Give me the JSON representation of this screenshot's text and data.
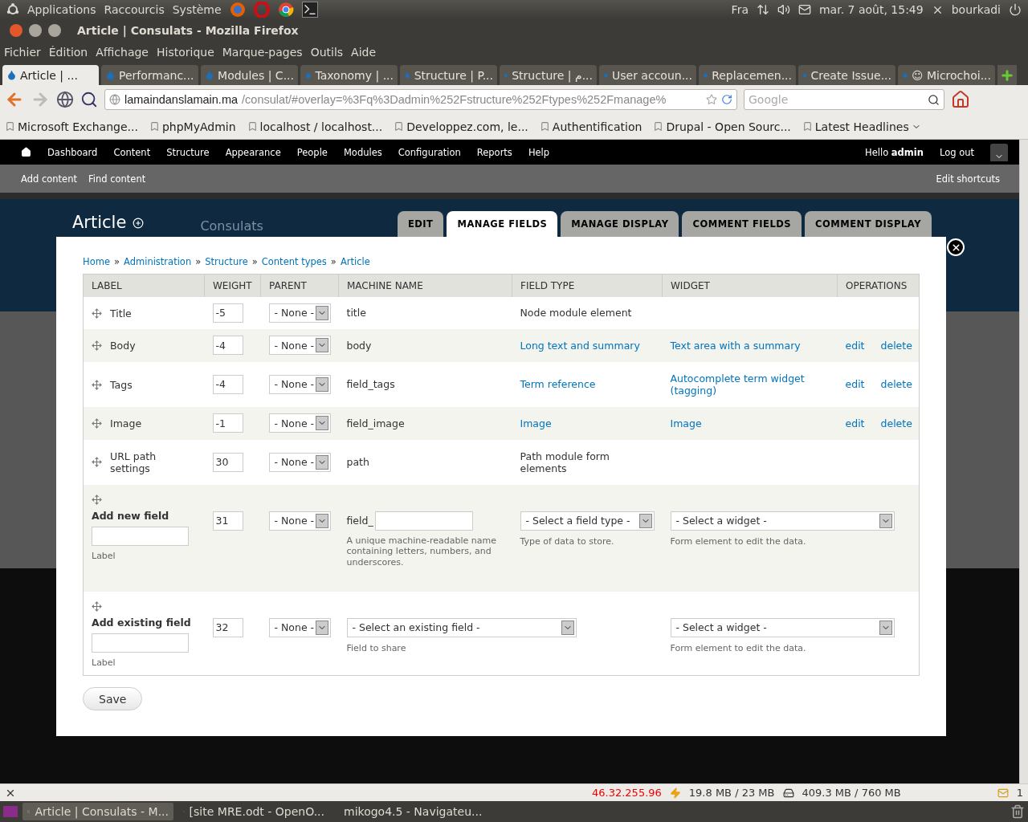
{
  "panel": {
    "menus": [
      "Applications",
      "Raccourcis",
      "Système"
    ],
    "keyboard": "Fra",
    "clock": "mar.  7 août, 15:49",
    "user": "bourkadi"
  },
  "window": {
    "title": "Article | Consulats - Mozilla Firefox"
  },
  "menubar": [
    "Fichier",
    "Édition",
    "Affichage",
    "Historique",
    "Marque-pages",
    "Outils",
    "Aide"
  ],
  "tabs": [
    {
      "label": "Article | ...",
      "selected": true
    },
    {
      "label": "Performanc...",
      "selected": false
    },
    {
      "label": "Modules | C...",
      "selected": false
    },
    {
      "label": "Taxonomy | ...",
      "selected": false
    },
    {
      "label": "Structure | P...",
      "selected": false
    },
    {
      "label": "Structure | م...",
      "selected": false
    },
    {
      "label": "User accoun...",
      "selected": false
    },
    {
      "label": "Replacemen...",
      "selected": false
    },
    {
      "label": "Create Issue...",
      "selected": false
    },
    {
      "label": "☺ Microchoi...",
      "selected": false
    }
  ],
  "address": {
    "host": "lamaindanslamain.ma",
    "path": "/consulat/#overlay=%3Fq%3Dadmin%252Fstructure%252Ftypes%252Fmanage%"
  },
  "search": {
    "placeholder": "Google"
  },
  "bookmarks": [
    "Microsoft Exchange...",
    "phpMyAdmin",
    "localhost / localhost...",
    "Developpez.com, le...",
    "Authentification",
    "Drupal - Open Sourc...",
    "Latest Headlines"
  ],
  "toolbar": {
    "items": [
      "Dashboard",
      "Content",
      "Structure",
      "Appearance",
      "People",
      "Modules",
      "Configuration",
      "Reports",
      "Help"
    ],
    "greeting": "Hello **admin**",
    "logout": "Log out",
    "shortcuts": [
      "Add content",
      "Find content"
    ],
    "edit_shortcuts": "Edit shortcuts"
  },
  "header": {
    "title": "Article",
    "site_name": "Consulats",
    "tabs": [
      {
        "label": "EDIT",
        "selected": false
      },
      {
        "label": "MANAGE FIELDS",
        "selected": true
      },
      {
        "label": "MANAGE DISPLAY",
        "selected": false
      },
      {
        "label": "COMMENT FIELDS",
        "selected": false
      },
      {
        "label": "COMMENT DISPLAY",
        "selected": false
      }
    ]
  },
  "breadcrumb": [
    {
      "label": "Home",
      "separator": "»"
    },
    {
      "label": "Administration",
      "separator": "»"
    },
    {
      "label": "Structure",
      "separator": "»"
    },
    {
      "label": "Content types",
      "separator": "»"
    },
    {
      "label": "Article"
    }
  ],
  "table": {
    "columns": [
      "LABEL",
      "WEIGHT",
      "PARENT",
      "MACHINE NAME",
      "FIELD TYPE",
      "WIDGET",
      "OPERATIONS"
    ],
    "rows": [
      {
        "kind": "field",
        "label": "Title",
        "weight": "-5",
        "parent": "- None -",
        "machine_name": "title",
        "field_type": "Node module element",
        "linked": false
      },
      {
        "kind": "field",
        "label": "Body",
        "weight": "-4",
        "parent": "- None -",
        "machine_name": "body",
        "field_type": "Long text and summary",
        "widget": "Text area with a summary",
        "operations": [
          "edit",
          "delete"
        ],
        "linked": true
      },
      {
        "kind": "field",
        "label": "Tags",
        "weight": "-4",
        "parent": "- None -",
        "machine_name": "field_tags",
        "field_type": "Term reference",
        "widget": "Autocomplete term widget (tagging)",
        "operations": [
          "edit",
          "delete"
        ],
        "linked": true
      },
      {
        "kind": "field",
        "label": "Image",
        "weight": "-1",
        "parent": "- None -",
        "machine_name": "field_image",
        "field_type": "Image",
        "widget": "Image",
        "operations": [
          "edit",
          "delete"
        ],
        "linked": true
      },
      {
        "kind": "field",
        "label": "URL path settings",
        "weight": "30",
        "parent": "- None -",
        "machine_name": "path",
        "field_type": "Path module form elements",
        "linked": false
      },
      {
        "kind": "new",
        "label": "Add new field",
        "label_hint": "Label",
        "weight": "31",
        "parent": "- None -",
        "machine_prefix": "field_",
        "machine_hint": "A unique machine-readable name containing letters, numbers, and underscores.",
        "type_select": "- Select a field type -",
        "type_hint": "Type of data to store.",
        "widget_select": "- Select a widget -",
        "widget_hint": "Form element to edit the data."
      },
      {
        "kind": "existing",
        "label": "Add existing field",
        "label_hint": "Label",
        "weight": "32",
        "parent": "- None -",
        "field_select": "- Select an existing field -",
        "field_hint": "Field to share",
        "widget_select": "- Select a widget -",
        "widget_hint": "Form element to edit the data."
      }
    ]
  },
  "save": "Save",
  "status_bar": {
    "ip": "46.32.255.96",
    "memory": "19.8 MB / 23 MB",
    "disk": "409.3 MB / 760 MB",
    "mail_count": "1"
  },
  "taskbar": [
    {
      "label": "Article | Consulats - M...",
      "selected": true
    },
    {
      "label": "[site MRE.odt - OpenO...",
      "selected": false
    },
    {
      "label": "mikogo4.5 - Navigateu...",
      "selected": false
    }
  ]
}
